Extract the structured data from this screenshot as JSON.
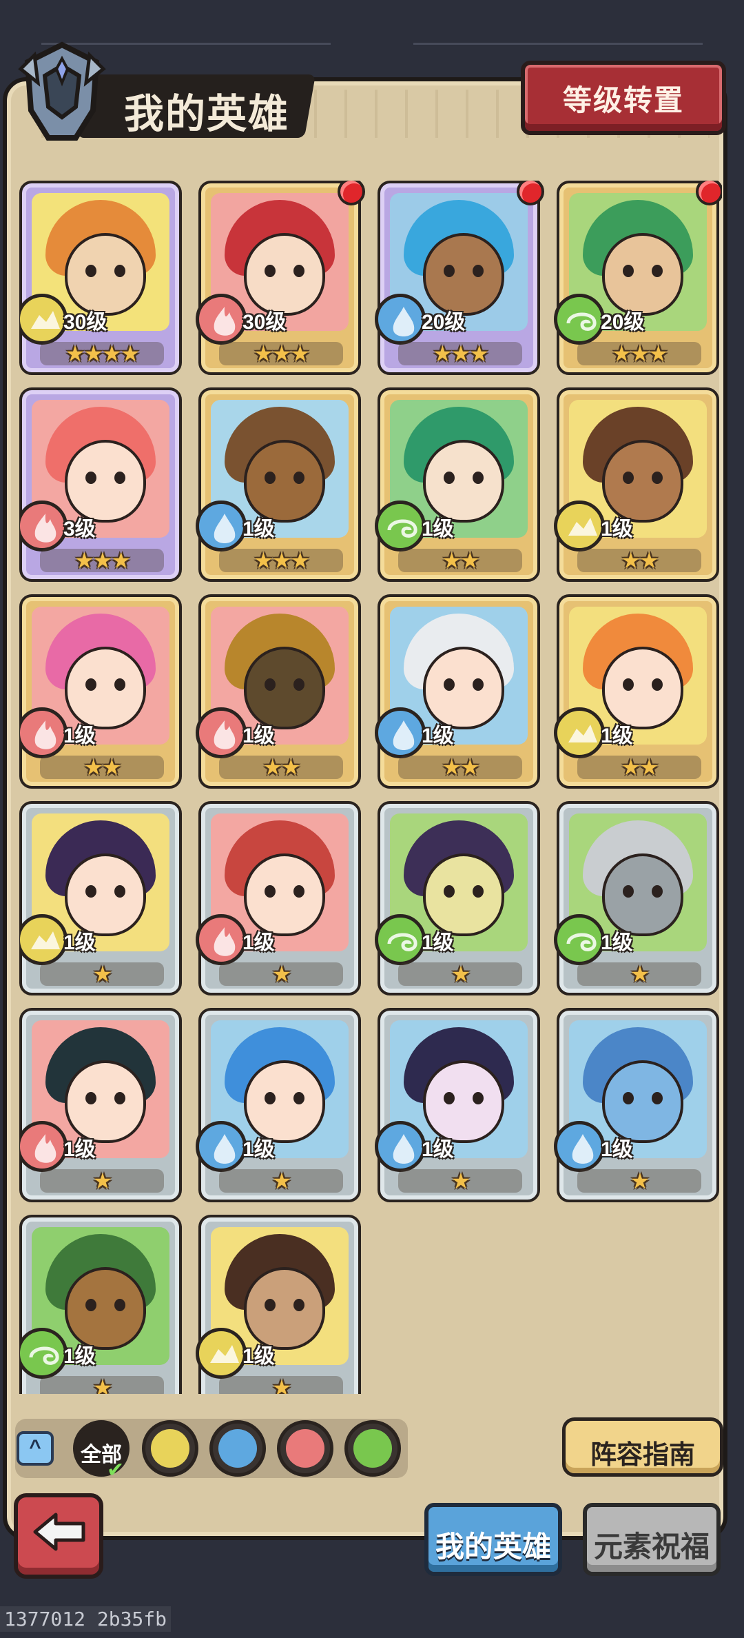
{
  "header": {
    "title": "我的英雄",
    "level_transfer_label": "等级转置"
  },
  "heroes": [
    {
      "level": "30级",
      "stars": "★★★★",
      "element": "earth",
      "frame": "purple",
      "red_dot": false,
      "hair": "#e58b3a",
      "skin": "#f0d3b0",
      "bg": "#f3e27a"
    },
    {
      "level": "30级",
      "stars": "★★★",
      "element": "fire",
      "frame": "gold",
      "red_dot": true,
      "hair": "#c8343a",
      "skin": "#f7dcc6",
      "bg": "#f2a5a0"
    },
    {
      "level": "20级",
      "stars": "★★★",
      "element": "water",
      "frame": "purple",
      "red_dot": true,
      "hair": "#39a7dd",
      "skin": "#a9784f",
      "bg": "#9ccbe8"
    },
    {
      "level": "20级",
      "stars": "★★★",
      "element": "wind",
      "frame": "gold",
      "red_dot": true,
      "hair": "#3c9d5b",
      "skin": "#e8c49a",
      "bg": "#a9d67c"
    },
    {
      "level": "3级",
      "stars": "★★★",
      "element": "fire",
      "frame": "purple",
      "red_dot": false,
      "hair": "#ef6f6a",
      "skin": "#fbe0cf",
      "bg": "#f3a7a2"
    },
    {
      "level": "1级",
      "stars": "★★★",
      "element": "water",
      "frame": "gold",
      "red_dot": false,
      "hair": "#7a5230",
      "skin": "#9b6a3b",
      "bg": "#a9d6ea"
    },
    {
      "level": "1级",
      "stars": "★★",
      "element": "wind",
      "frame": "gold",
      "red_dot": false,
      "hair": "#2f9a6a",
      "skin": "#f6e1cc",
      "bg": "#8fd08a"
    },
    {
      "level": "1级",
      "stars": "★★",
      "element": "earth",
      "frame": "gold",
      "red_dot": false,
      "hair": "#6a4128",
      "skin": "#b07a4e",
      "bg": "#f3df7e"
    },
    {
      "level": "1级",
      "stars": "★★",
      "element": "fire",
      "frame": "gold",
      "red_dot": false,
      "hair": "#e86aa6",
      "skin": "#fbe0cf",
      "bg": "#f3a7a2"
    },
    {
      "level": "1级",
      "stars": "★★",
      "element": "fire",
      "frame": "gold",
      "red_dot": false,
      "hair": "#b8862c",
      "skin": "#5e4a2d",
      "bg": "#f3a7a2"
    },
    {
      "level": "1级",
      "stars": "★★",
      "element": "water",
      "frame": "gold",
      "red_dot": false,
      "hair": "#e9ecef",
      "skin": "#fbe0cf",
      "bg": "#9fd0ea"
    },
    {
      "level": "1级",
      "stars": "★★",
      "element": "earth",
      "frame": "gold",
      "red_dot": false,
      "hair": "#f08a3c",
      "skin": "#fbe0cf",
      "bg": "#f3df7e"
    },
    {
      "level": "1级",
      "stars": "★",
      "element": "earth",
      "frame": "silver",
      "red_dot": false,
      "hair": "#3b2a55",
      "skin": "#fbe0cf",
      "bg": "#f3df7e"
    },
    {
      "level": "1级",
      "stars": "★",
      "element": "fire",
      "frame": "silver",
      "red_dot": false,
      "hair": "#c8463f",
      "skin": "#fbe0cf",
      "bg": "#f3a7a2"
    },
    {
      "level": "1级",
      "stars": "★",
      "element": "wind",
      "frame": "silver",
      "red_dot": false,
      "hair": "#3d2f57",
      "skin": "#e9e3a0",
      "bg": "#a9d67c"
    },
    {
      "level": "1级",
      "stars": "★",
      "element": "wind",
      "frame": "silver",
      "red_dot": false,
      "hair": "#c9cdd0",
      "skin": "#9aa2a6",
      "bg": "#a9d67c"
    },
    {
      "level": "1级",
      "stars": "★",
      "element": "fire",
      "frame": "silver",
      "red_dot": false,
      "hair": "#22343a",
      "skin": "#fbe0cf",
      "bg": "#f3a7a2"
    },
    {
      "level": "1级",
      "stars": "★",
      "element": "water",
      "frame": "silver",
      "red_dot": false,
      "hair": "#3f8fdb",
      "skin": "#fbe0cf",
      "bg": "#9fd0ea"
    },
    {
      "level": "1级",
      "stars": "★",
      "element": "water",
      "frame": "silver",
      "red_dot": false,
      "hair": "#2e2a4f",
      "skin": "#f1dff0",
      "bg": "#9fd0ea"
    },
    {
      "level": "1级",
      "stars": "★",
      "element": "water",
      "frame": "silver",
      "red_dot": false,
      "hair": "#4b86c8",
      "skin": "#7fb6e3",
      "bg": "#9fd0ea"
    },
    {
      "level": "1级",
      "stars": "★",
      "element": "wind",
      "frame": "silver",
      "red_dot": false,
      "hair": "#3f7a3a",
      "skin": "#a4743f",
      "bg": "#8fcf6e"
    },
    {
      "level": "1级",
      "stars": "★",
      "element": "earth",
      "frame": "silver",
      "red_dot": false,
      "hair": "#4a2f22",
      "skin": "#caa07a",
      "bg": "#f3df7e"
    }
  ],
  "filter": {
    "all_label": "全部",
    "elements": [
      "earth",
      "water",
      "fire",
      "wind"
    ]
  },
  "lineup_guide_label": "阵容指南",
  "tabs": {
    "my_heroes": "我的英雄",
    "element_blessing": "元素祝福"
  },
  "build_info": "1377012 2b35fb",
  "colors": {
    "fire": "#e97a7a",
    "water": "#5ea8e0",
    "wind": "#79c74e",
    "earth": "#e8d35a",
    "accent_red": "#a72f35",
    "accent_blue": "#5aa3da"
  }
}
